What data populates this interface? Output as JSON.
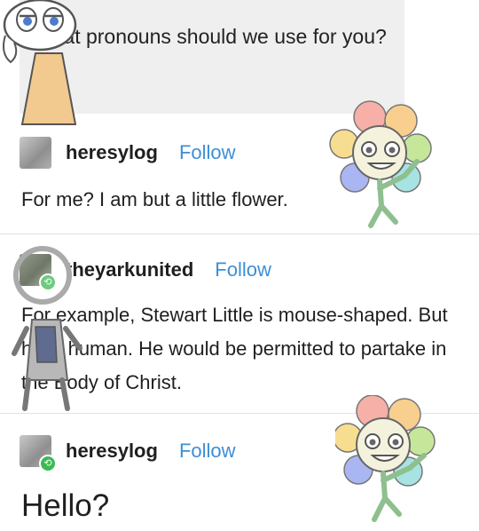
{
  "ask": {
    "question": "what pronouns should we use for you?"
  },
  "posts": [
    {
      "username": "heresylog",
      "follow_label": "Follow",
      "text": "For me? I am but a little flower."
    },
    {
      "username": "theyarkunited",
      "follow_label": "Follow",
      "text": "For example, Stewart Little is mouse-shaped. But he is human. He would be permitted to partake in the Body of Christ."
    },
    {
      "username": "heresylog",
      "follow_label": "Follow",
      "text": "Hello?"
    }
  ],
  "icons": {
    "reblog": "reblog-icon",
    "flower_character": "flower-character-doodle",
    "ghost_character": "ghost-character-doodle",
    "magnifier_character": "magnifier-character-doodle"
  },
  "colors": {
    "follow_link": "#3d8fd6",
    "reblog_badge": "#3cba54",
    "ask_background": "#efefef"
  }
}
